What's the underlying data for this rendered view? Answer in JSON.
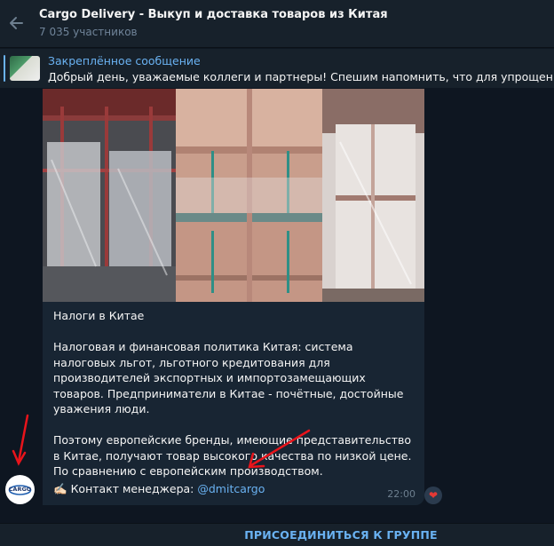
{
  "header": {
    "title": "Cargo Delivery - Выкуп и доставка товаров из Китая",
    "members": "7 035 участников",
    "back_icon": "arrow-left-icon"
  },
  "pinned": {
    "label": "Закреплённое сообщение",
    "text": "Добрый день, уважаемые коллеги и партнеры!   Спешим напомнить, что для упрощения В"
  },
  "message": {
    "heading": "Налоги в Китае",
    "paragraph1": "Налоговая и финансовая политика Китая: система налоговых льгот, льготного кредитования для производителей экспортных и импортозамещающих товаров. Предприниматели в Китае - почётные, достойные уважения люди.",
    "paragraph2": "Поэтому европейские бренды, имеющие представительство в Китае, получают товар высокого качества по низкой цене. По сравнению с европейским производством.",
    "contact_emoji": "✍🏻",
    "contact_prefix": "Контакт менеджера: ",
    "contact_link": "@dmitcargo",
    "time": "22:00",
    "reaction": "❤"
  },
  "avatar": {
    "text": "CARGO"
  },
  "join_button": "ПРИСОЕДИНИТЬСЯ К ГРУППЕ",
  "colors": {
    "background": "#0e1621",
    "header": "#17212b",
    "bubble": "#182533",
    "accent": "#6ab2f2",
    "annotation_arrow": "#e8141b"
  }
}
